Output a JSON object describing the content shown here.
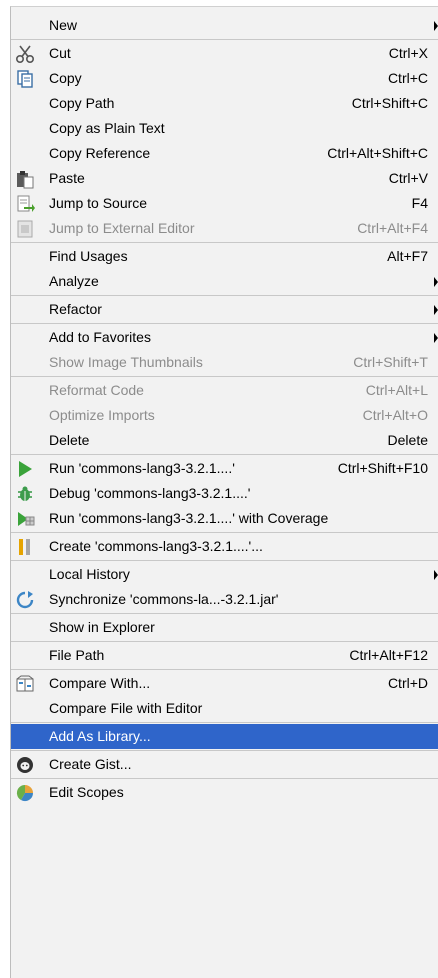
{
  "menu": {
    "new": "New",
    "cut": {
      "label": "Cut",
      "shortcut": "Ctrl+X"
    },
    "copy": {
      "label": "Copy",
      "shortcut": "Ctrl+C"
    },
    "copy_path": {
      "label": "Copy Path",
      "shortcut": "Ctrl+Shift+C"
    },
    "copy_plain": {
      "label": "Copy as Plain Text"
    },
    "copy_ref": {
      "label": "Copy Reference",
      "shortcut": "Ctrl+Alt+Shift+C"
    },
    "paste": {
      "label": "Paste",
      "shortcut": "Ctrl+V"
    },
    "jump_source": {
      "label": "Jump to Source",
      "shortcut": "F4"
    },
    "jump_external": {
      "label": "Jump to External Editor",
      "shortcut": "Ctrl+Alt+F4"
    },
    "find_usages": {
      "label": "Find Usages",
      "shortcut": "Alt+F7"
    },
    "analyze": {
      "label": "Analyze"
    },
    "refactor": {
      "label": "Refactor"
    },
    "add_favorites": {
      "label": "Add to Favorites"
    },
    "show_thumbs": {
      "label": "Show Image Thumbnails",
      "shortcut": "Ctrl+Shift+T"
    },
    "reformat": {
      "label": "Reformat Code",
      "shortcut": "Ctrl+Alt+L"
    },
    "optimize": {
      "label": "Optimize Imports",
      "shortcut": "Ctrl+Alt+O"
    },
    "delete": {
      "label": "Delete",
      "shortcut": "Delete"
    },
    "run": {
      "label": "Run 'commons-lang3-3.2.1....'",
      "shortcut": "Ctrl+Shift+F10"
    },
    "debug": {
      "label": "Debug 'commons-lang3-3.2.1....'"
    },
    "coverage": {
      "label": "Run 'commons-lang3-3.2.1....' with Coverage"
    },
    "create": {
      "label": "Create 'commons-lang3-3.2.1....'..."
    },
    "local_history": {
      "label": "Local History"
    },
    "synchronize": {
      "label": "Synchronize 'commons-la...-3.2.1.jar'"
    },
    "show_explorer": {
      "label": "Show in Explorer"
    },
    "file_path": {
      "label": "File Path",
      "shortcut": "Ctrl+Alt+F12"
    },
    "compare_with": {
      "label": "Compare With...",
      "shortcut": "Ctrl+D"
    },
    "compare_editor": {
      "label": "Compare File with Editor"
    },
    "add_library": {
      "label": "Add As Library..."
    },
    "create_gist": {
      "label": "Create Gist..."
    },
    "edit_scopes": {
      "label": "Edit Scopes"
    }
  },
  "colors": {
    "selection": "#2f65ca",
    "menu_bg": "#f2f2f2",
    "disabled": "#8c8c8c"
  }
}
